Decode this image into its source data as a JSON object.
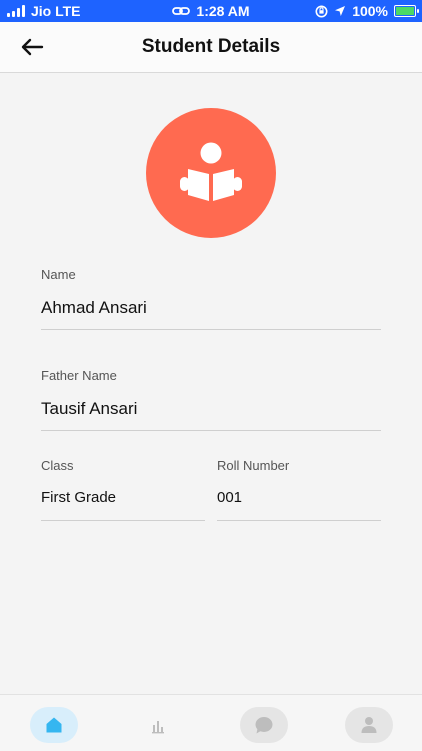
{
  "status_bar": {
    "carrier": "Jio LTE",
    "time": "1:28 AM",
    "battery": "100%"
  },
  "header": {
    "title": "Student Details",
    "back_icon": "arrow-left-icon"
  },
  "avatar": {
    "icon": "student-reading-icon",
    "color": "#ff6a50"
  },
  "fields": {
    "name": {
      "label": "Name",
      "value": "Ahmad Ansari"
    },
    "father_name": {
      "label": "Father Name",
      "value": "Tausif Ansari"
    },
    "class": {
      "label": "Class",
      "value": "First Grade"
    },
    "roll_number": {
      "label": "Roll Number",
      "value": "001"
    }
  },
  "bottom_nav": {
    "items": [
      {
        "icon": "home-icon",
        "active": true
      },
      {
        "icon": "bar-chart-icon",
        "active": false
      },
      {
        "icon": "chat-bubble-icon",
        "active": false
      },
      {
        "icon": "profile-icon",
        "active": false
      }
    ]
  },
  "colors": {
    "status_bar": "#1e63ff",
    "accent": "#ff6a50",
    "active_nav": "#d8eefb",
    "active_icon": "#35b6f0"
  }
}
